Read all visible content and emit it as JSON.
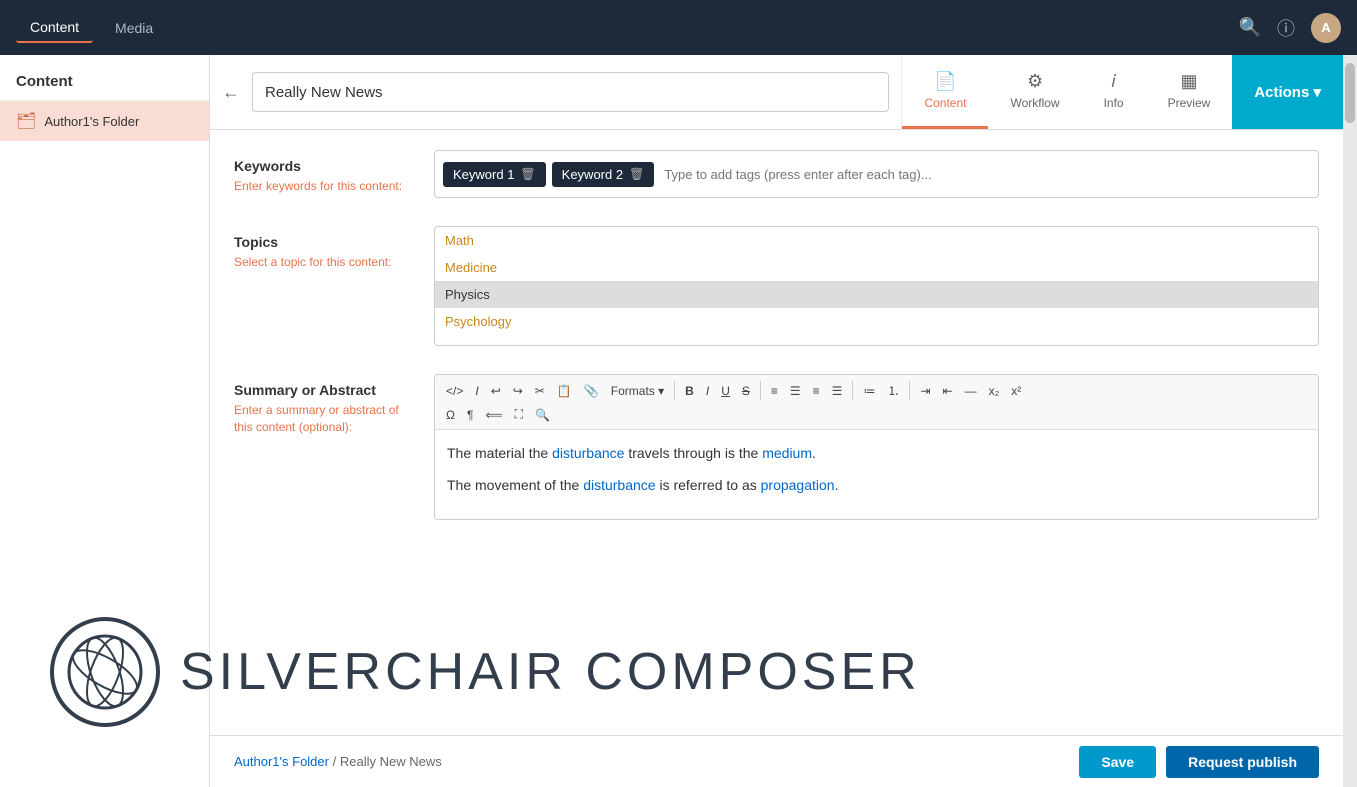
{
  "topnav": {
    "items": [
      {
        "label": "Content",
        "active": true
      },
      {
        "label": "Media",
        "active": false
      }
    ],
    "icons": [
      "search",
      "help",
      "user"
    ],
    "user_initial": "A"
  },
  "sidebar": {
    "header": "Content",
    "items": [
      {
        "label": "Author1's Folder",
        "icon": "folder"
      }
    ]
  },
  "titlebar": {
    "back_label": "←",
    "title_value": "Really New News",
    "tabs": [
      {
        "label": "Content",
        "icon": "📄",
        "active": true
      },
      {
        "label": "Workflow",
        "icon": "🔄",
        "active": false
      },
      {
        "label": "Info",
        "icon": "ℹ",
        "active": false
      },
      {
        "label": "Preview",
        "icon": "▦",
        "active": false
      }
    ],
    "actions_label": "Actions ▾"
  },
  "form": {
    "keywords": {
      "label": "Keywords",
      "sublabel": "Enter keywords for this content:",
      "tags": [
        {
          "text": "Keyword 1"
        },
        {
          "text": "Keyword 2"
        }
      ],
      "placeholder": "Type to add tags (press enter after each tag)..."
    },
    "topics": {
      "label": "Topics",
      "sublabel": "Select a topic for this content:",
      "items": [
        {
          "label": "Math",
          "selected": false
        },
        {
          "label": "Medicine",
          "selected": false
        },
        {
          "label": "Physics",
          "selected": true
        },
        {
          "label": "Psychology",
          "selected": false
        }
      ]
    },
    "summary": {
      "label": "Summary or Abstract",
      "sublabel": "Enter a summary or abstract of this content (optional):",
      "content_lines": [
        "The material the disturbance travels through is the medium.",
        "The movement of the disturbance is referred to as propagation."
      ],
      "link_words": [
        "disturbance",
        "medium",
        "disturbance",
        "propagation"
      ]
    }
  },
  "bottombar": {
    "breadcrumb_folder": "Author1's Folder",
    "breadcrumb_item": "Really New News",
    "save_label": "Save",
    "publish_label": "Request publish"
  },
  "logo": {
    "text": "SILVERCHAIR COMPOSER"
  },
  "colors": {
    "accent": "#e8734a",
    "nav_bg": "#1e2a3a",
    "actions_bg": "#00aacc",
    "link": "#0066cc",
    "topic_orange": "#c8871a",
    "keyword_bg": "#1e2a3a"
  }
}
